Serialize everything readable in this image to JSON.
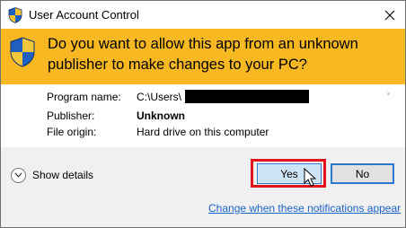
{
  "window": {
    "title": "User Account Control",
    "close_icon": "close-icon"
  },
  "banner": {
    "question": "Do you want to allow this app from an unknown publisher to make changes to your PC?",
    "icon": "uac-shield-icon",
    "color": "#f7b822"
  },
  "details": {
    "program_name_label": "Program name:",
    "program_name_value": "C:\\Users\\",
    "publisher_label": "Publisher:",
    "publisher_value": "Unknown",
    "file_origin_label": "File origin:",
    "file_origin_value": "Hard drive on this computer"
  },
  "footer": {
    "show_details_label": "Show details",
    "yes_label": "Yes",
    "no_label": "No",
    "link_text": "Change when these notifications appear",
    "highlight_color": "#e0141a",
    "link_color": "#1a63c9"
  }
}
